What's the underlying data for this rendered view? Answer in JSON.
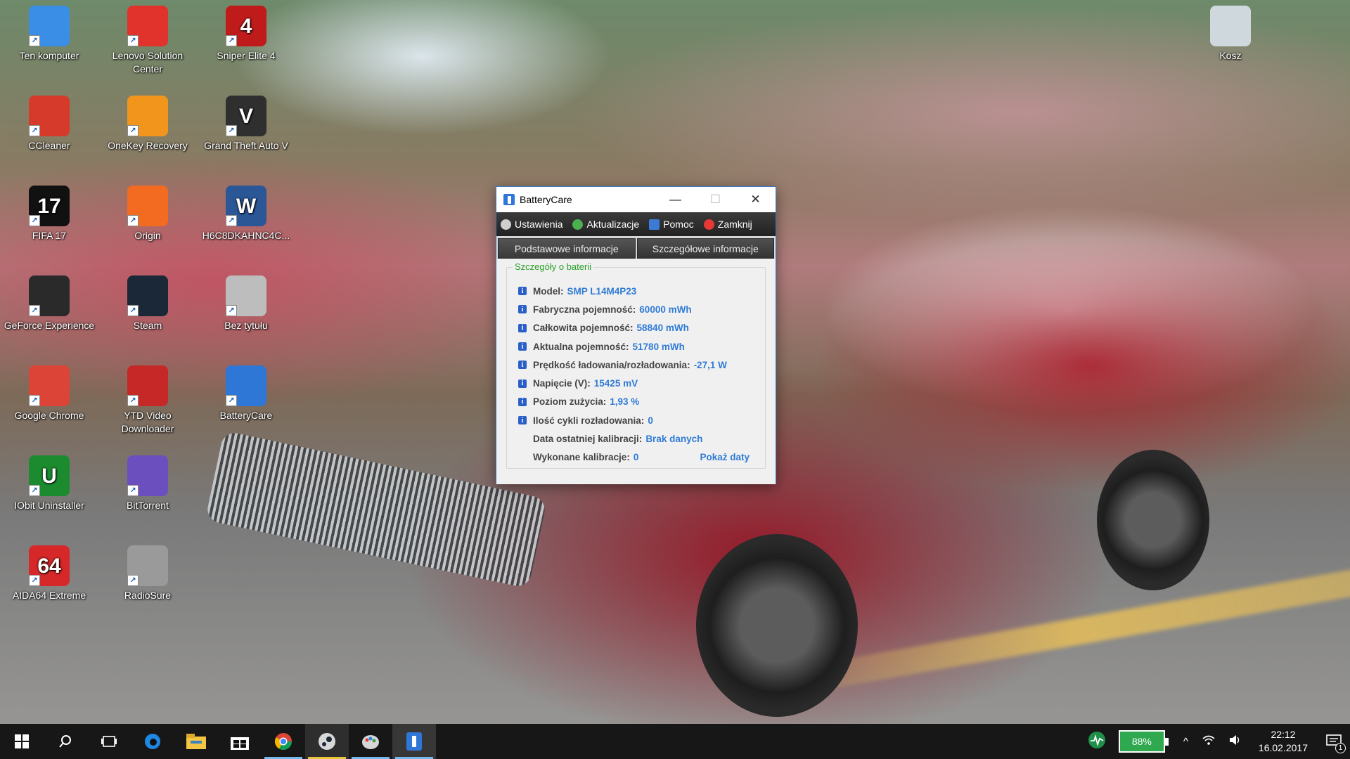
{
  "desktop": {
    "icons": [
      {
        "label": "Ten komputer",
        "icon": "computer-icon",
        "color": "#3a8ee6"
      },
      {
        "label": "Lenovo Solution Center",
        "icon": "lenovo-solution-icon",
        "color": "#e1322b"
      },
      {
        "label": "Sniper Elite 4",
        "icon": "sniper-elite-icon",
        "color": "#c01b1b",
        "glyph": "4"
      },
      {
        "label": "CCleaner",
        "icon": "ccleaner-icon",
        "color": "#d63a2b"
      },
      {
        "label": "OneKey Recovery",
        "icon": "onekey-recovery-icon",
        "color": "#f2951d"
      },
      {
        "label": "Grand Theft Auto V",
        "icon": "gta-v-icon",
        "color": "#2f2f2f",
        "glyph": "V"
      },
      {
        "label": "FIFA 17",
        "icon": "fifa17-icon",
        "color": "#111111",
        "glyph": "17"
      },
      {
        "label": "Origin",
        "icon": "origin-icon",
        "color": "#f26b21"
      },
      {
        "label": "H6C8DKAHNC4C...",
        "icon": "word-document-icon",
        "color": "#2b5797",
        "glyph": "W"
      },
      {
        "label": "GeForce Experience",
        "icon": "geforce-icon",
        "color": "#2a2a2a"
      },
      {
        "label": "Steam",
        "icon": "steam-icon",
        "color": "#1b2838"
      },
      {
        "label": "Bez tytułu",
        "icon": "image-file-icon",
        "color": "#bdbdbd"
      },
      {
        "label": "Google Chrome",
        "icon": "chrome-icon",
        "color": "#db4437"
      },
      {
        "label": "YTD Video Downloader",
        "icon": "ytd-downloader-icon",
        "color": "#c62828"
      },
      {
        "label": "BatteryCare",
        "icon": "batterycare-icon",
        "color": "#2f77d6"
      },
      {
        "label": "IObit Uninstaller",
        "icon": "iobit-uninstaller-icon",
        "color": "#1c8a2e",
        "glyph": "U"
      },
      {
        "label": "BitTorrent",
        "icon": "bittorrent-icon",
        "color": "#6b4fbf"
      },
      {
        "label": "AIDA64 Extreme",
        "icon": "aida64-icon",
        "color": "#d62828",
        "glyph": "64"
      },
      {
        "label": "RadioSure",
        "icon": "radiosure-icon",
        "color": "#9a9a9a"
      },
      {
        "label": "Kosz",
        "icon": "recycle-bin-icon",
        "color": "#cfd8dc"
      }
    ]
  },
  "window": {
    "title": "BatteryCare",
    "controls": {
      "minimize": "—",
      "maximize": "☐",
      "close": "✕"
    },
    "menu": [
      {
        "label": "Ustawienia",
        "icon": "gear-icon",
        "color": "#d0d0d0"
      },
      {
        "label": "Aktualizacje",
        "icon": "refresh-icon",
        "color": "#4caf50"
      },
      {
        "label": "Pomoc",
        "icon": "help-icon",
        "color": "#3b7bd6"
      },
      {
        "label": "Zamknij",
        "icon": "close-icon",
        "color": "#e53935"
      }
    ],
    "tabs": [
      "Podstawowe informacje",
      "Szczegółowe informacje"
    ],
    "group_title": "Szczegóły o baterii",
    "details": [
      {
        "label": "Model:",
        "value": "SMP L14M4P23"
      },
      {
        "label": "Fabryczna pojemność:",
        "value": "60000 mWh"
      },
      {
        "label": "Całkowita pojemność:",
        "value": "58840 mWh"
      },
      {
        "label": "Aktualna pojemność:",
        "value": "51780 mWh"
      },
      {
        "label": "Prędkość ładowania/rozładowania:",
        "value": "-27,1 W"
      },
      {
        "label": "Napięcie (V):",
        "value": "15425 mV"
      },
      {
        "label": "Poziom zużycia:",
        "value": "1,93 %"
      },
      {
        "label": "Ilość cykli rozładowania:",
        "value": "0"
      }
    ],
    "calibration_date": {
      "label": "Data ostatniej kalibracji:",
      "value": "Brak danych"
    },
    "calibrations_done": {
      "label": "Wykonane kalibracje:",
      "value": "0",
      "link": "Pokaż daty"
    }
  },
  "taskbar": {
    "apps": [
      "start-icon",
      "search-icon",
      "task-view-icon",
      "edge-icon",
      "file-explorer-icon",
      "store-icon",
      "chrome-icon",
      "steam-icon",
      "paint-icon",
      "batterycare-icon"
    ],
    "battery_percent": "88%",
    "time": "22:12",
    "date": "16.02.2017",
    "notification_count": "1"
  }
}
